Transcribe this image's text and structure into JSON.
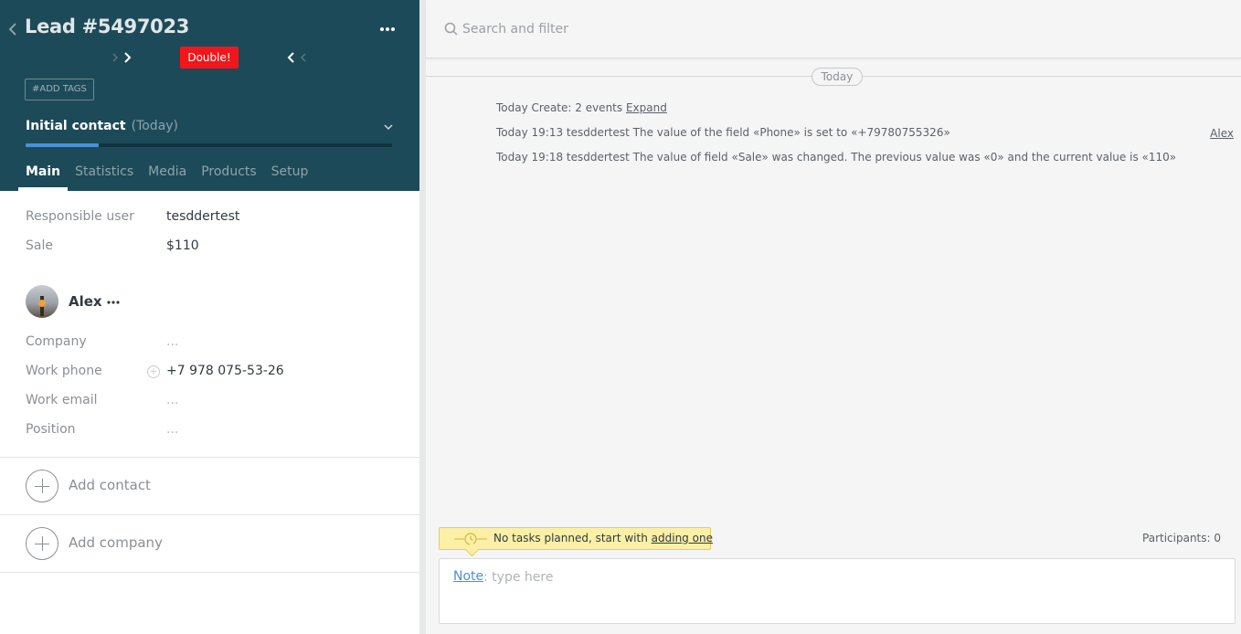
{
  "lead": {
    "title": "Lead #5497023",
    "double_badge": "Double!",
    "add_tags": "#ADD TAGS",
    "status_name": "Initial contact",
    "status_date": "(Today)",
    "progress_fraction": 0.2,
    "tabs": [
      "Main",
      "Statistics",
      "Media",
      "Products",
      "Setup"
    ],
    "active_tab": "Main"
  },
  "fields": {
    "responsible_label": "Responsible user",
    "responsible_value": "tesddertest",
    "sale_label": "Sale",
    "sale_value": "$110"
  },
  "contact": {
    "name": "Alex",
    "company_label": "Company",
    "company_value": "...",
    "work_phone_label": "Work phone",
    "work_phone_value": "+7 978 075-53-26",
    "work_email_label": "Work email",
    "work_email_value": "...",
    "position_label": "Position",
    "position_value": "..."
  },
  "actions": {
    "add_contact": "Add contact",
    "add_company": "Add company"
  },
  "feed": {
    "search_placeholder": "Search and filter",
    "date_separator": "Today",
    "summary_prefix": "Today Create: 2 events",
    "summary_expand": "Expand",
    "events": [
      "Today 19:13 tesddertest The value of the field «Phone» is set to «+79780755326»",
      "Today 19:18 tesddertest The value of field «Sale» was changed. The previous value was «0» and the current value is «110»"
    ],
    "event_author": "Alex",
    "task_text": "No tasks planned, start with",
    "task_link": "adding one",
    "participants": "Participants: 0",
    "note_type": "Note",
    "note_placeholder": ": type here"
  },
  "icons": {
    "back": "chevron-left-icon",
    "more": "ellipsis-icon",
    "search": "search-icon",
    "clock": "clock-icon",
    "status_toggle": "chevron-down-icon"
  },
  "colors": {
    "header_bg": "#1d4a58",
    "double_badge": "#f2161c",
    "progress": "#4a90d9",
    "task_banner": "#fcf0a6",
    "note_link": "#4a90d9"
  }
}
